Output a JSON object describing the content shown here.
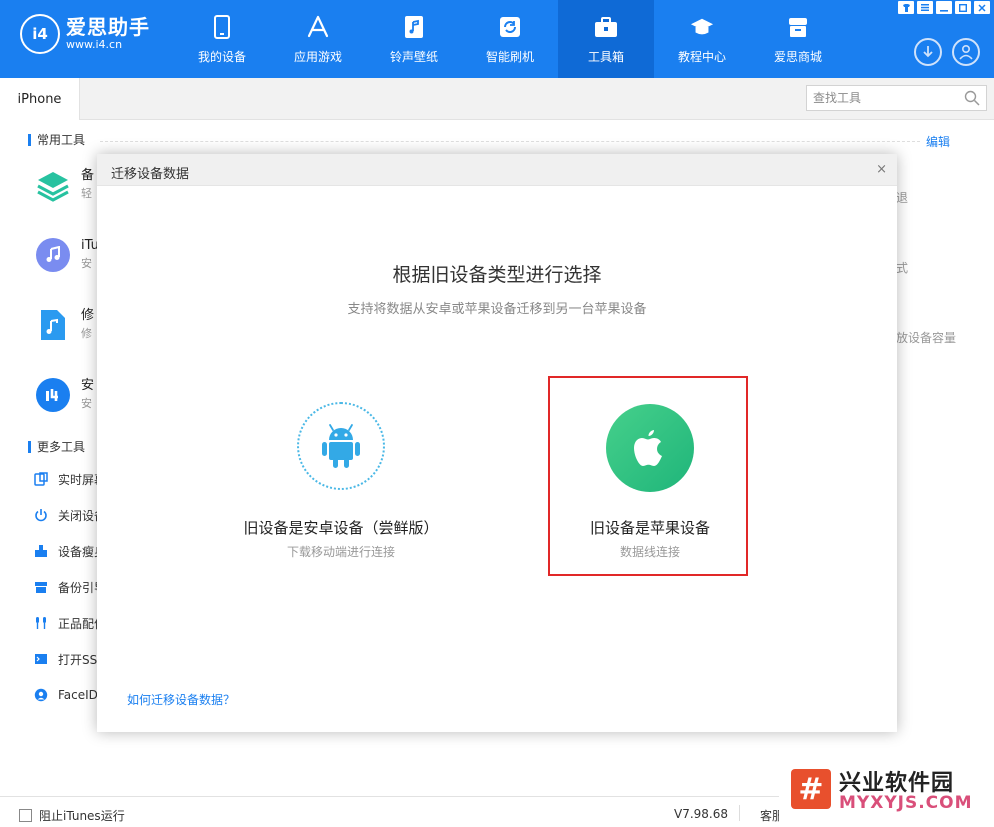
{
  "app": {
    "logo_badge": "i4",
    "logo_name": "爱思助手",
    "logo_url": "www.i4.cn"
  },
  "nav": {
    "items": [
      {
        "label": "我的设备",
        "icon": "phone-icon"
      },
      {
        "label": "应用游戏",
        "icon": "app-store-icon"
      },
      {
        "label": "铃声壁纸",
        "icon": "music-file-icon"
      },
      {
        "label": "智能刷机",
        "icon": "refresh-box-icon"
      },
      {
        "label": "工具箱",
        "icon": "toolbox-icon"
      },
      {
        "label": "教程中心",
        "icon": "graduation-cap-icon"
      },
      {
        "label": "爱思商城",
        "icon": "store-icon"
      }
    ],
    "active_index": 4
  },
  "subbar": {
    "device_tab": "iPhone",
    "search_placeholder": "查找工具"
  },
  "sections": {
    "common_title": "常用工具",
    "edit_label": "编辑",
    "more_title": "更多工具"
  },
  "common_tools": [
    {
      "name": "备",
      "desc": "轻",
      "right_desc": "退"
    },
    {
      "name": "iTu",
      "desc": "安",
      "right_desc": "式"
    },
    {
      "name": "修",
      "desc": "修",
      "right_desc": "放设备容量"
    },
    {
      "name": "安",
      "desc": "安",
      "right_desc": ""
    }
  ],
  "more_tools": [
    {
      "label": "实时屏幕",
      "icon": "screen-icon"
    },
    {
      "label": "关闭设备",
      "icon": "power-icon"
    },
    {
      "label": "设备瘦身",
      "icon": "broom-icon"
    },
    {
      "label": "备份引导",
      "icon": "archive-icon"
    },
    {
      "label": "正品配件",
      "icon": "earphone-icon"
    },
    {
      "label": "打开SS",
      "icon": "terminal-icon"
    },
    {
      "label": "FaceID",
      "icon": "face-id-icon"
    }
  ],
  "dialog": {
    "title": "迁移设备数据",
    "close_label": "×",
    "heading": "根据旧设备类型进行选择",
    "subheading": "支持将数据从安卓或苹果设备迁移到另一台苹果设备",
    "option_android_title": "旧设备是安卓设备（尝鲜版）",
    "option_android_desc": "下载移动端进行连接",
    "option_apple_title": "旧设备是苹果设备",
    "option_apple_desc": "数据线连接",
    "help_link": "如何迁移设备数据？"
  },
  "bottombar": {
    "block_itunes_label": "阻止iTunes运行",
    "version": "V7.98.68",
    "kefu": "客服"
  },
  "watermark": {
    "title": "兴业软件园",
    "url": "MYXYJS.COM"
  },
  "colors": {
    "brand_blue": "#1a7ff0",
    "nav_active": "#0f6ad6",
    "apple_green": "#1fb57a",
    "highlight_red": "#e12828"
  }
}
